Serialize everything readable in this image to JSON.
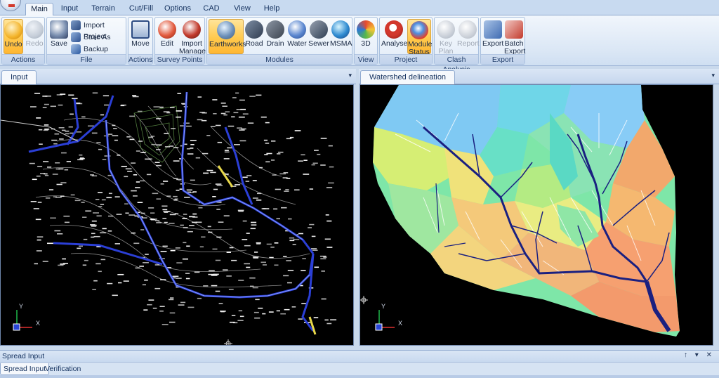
{
  "ribbon": {
    "tabs": [
      {
        "label": "Main",
        "active": true
      },
      {
        "label": "Input"
      },
      {
        "label": "Terrain"
      },
      {
        "label": "Cut/Fill"
      },
      {
        "label": "Options"
      },
      {
        "label": "CAD"
      },
      {
        "label": "View"
      },
      {
        "label": "Help"
      }
    ],
    "groups": {
      "actions": {
        "label": "Actions",
        "undo": "Undo",
        "redo": "Redo"
      },
      "file": {
        "label": "File",
        "save": "Save",
        "import_project": "Import Project",
        "save_as": "Save As",
        "backup": "Backup"
      },
      "actions2": {
        "label": "Actions",
        "move": "Move"
      },
      "survey": {
        "label": "Survey Points",
        "edit": "Edit",
        "import_line1": "Import",
        "import_line2": "Manage"
      },
      "modules": {
        "label": "Modules",
        "earthworks": "Earthworks",
        "road": "Road",
        "drain": "Drain",
        "water": "Water",
        "sewer": "Sewer",
        "msma": "MSMA"
      },
      "view": {
        "label": "View",
        "three_d": "3D"
      },
      "project": {
        "label": "Project",
        "analyse": "Analyse",
        "status_line1": "Module",
        "status_line2": "Status"
      },
      "clash": {
        "label": "Clash Analysis",
        "key_line1": "Key",
        "key_line2": "Plan",
        "report": "Report"
      },
      "export": {
        "label": "Export",
        "export": "Export",
        "batch_line1": "Batch",
        "batch_line2": "Export"
      }
    }
  },
  "panels": {
    "input": {
      "tab": "Input",
      "axis_y": "Y",
      "axis_x": "X"
    },
    "watershed": {
      "tab": "Watershed delineation",
      "axis_y": "Y",
      "axis_x": "X"
    }
  },
  "dock": {
    "title": "Spread Input",
    "controls": "↑ ▾ ✕",
    "tabs": [
      "Spread Input",
      "Verification"
    ]
  },
  "icons": {
    "dropdown": "▾"
  }
}
